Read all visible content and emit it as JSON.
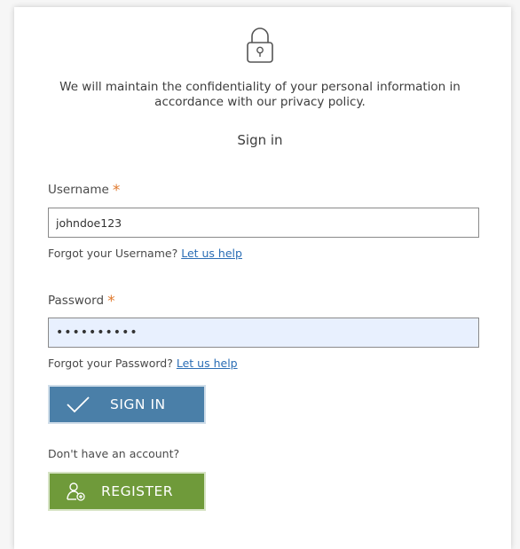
{
  "notice": "We will maintain the confidentiality of your personal information in accordance with our privacy policy.",
  "title": "Sign in",
  "username": {
    "label": "Username",
    "required_mark": "*",
    "value": "johndoe123",
    "help_text": "Forgot your Username?",
    "help_link": "Let us help"
  },
  "password": {
    "label": "Password",
    "required_mark": "*",
    "value": "••••••••••",
    "help_text": "Forgot your Password?",
    "help_link": "Let us help"
  },
  "signin_button": {
    "label": "SIGN IN",
    "icon": "checkmark-icon",
    "color": "#4a7fa8"
  },
  "no_account_text": "Don't have an account?",
  "register_button": {
    "label": "REGISTER",
    "icon": "add-user-icon",
    "color": "#6f9a3a"
  },
  "colors": {
    "required": "#e07a2e",
    "link": "#2a6db5",
    "password_field_bg": "#e8f0fe"
  }
}
